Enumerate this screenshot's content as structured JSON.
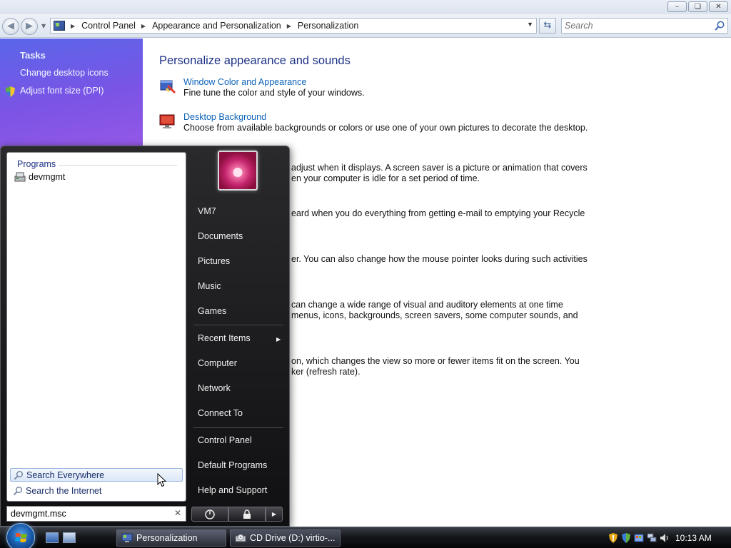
{
  "window": {
    "controls": {
      "minimize": "–",
      "maximize": "❏",
      "close": "✕"
    }
  },
  "addressbar": {
    "crumbs": [
      "Control Panel",
      "Appearance and Personalization",
      "Personalization"
    ],
    "search_placeholder": "Search"
  },
  "tasks": {
    "title": "Tasks",
    "links": [
      "Change desktop icons",
      "Adjust font size (DPI)"
    ]
  },
  "main": {
    "heading": "Personalize appearance and sounds",
    "items": [
      {
        "link": "Window Color and Appearance",
        "desc": "Fine tune the color and style of your windows."
      },
      {
        "link": "Desktop Background",
        "desc": "Choose from available backgrounds or colors or use one of your own pictures to decorate the desktop."
      }
    ],
    "fragments": [
      "adjust when it displays. A screen saver is a picture or animation that covers",
      "en your computer is idle for a set period of time.",
      "eard when you do everything from getting e-mail to emptying your Recycle",
      "er. You can also change how the mouse pointer looks during such activities",
      "can change a wide range of visual and auditory elements at one time",
      "menus, icons, backgrounds, screen savers, some computer sounds, and",
      "on, which changes the view so more or fewer items fit on the screen. You",
      "ker (refresh rate)."
    ]
  },
  "start_menu": {
    "programs_label": "Programs",
    "programs": [
      "devmgmt"
    ],
    "search_options": [
      "Search Everywhere",
      "Search the Internet"
    ],
    "search_value": "devmgmt.msc",
    "search_clear": "✕",
    "right_pane": [
      "VM7",
      "Documents",
      "Pictures",
      "Music",
      "Games",
      "Recent Items",
      "Computer",
      "Network",
      "Connect To",
      "Control Panel",
      "Default Programs",
      "Help and Support"
    ]
  },
  "taskbar": {
    "buttons": [
      "Personalization",
      "CD Drive (D:) virtio-..."
    ],
    "clock": "10:13 AM"
  }
}
